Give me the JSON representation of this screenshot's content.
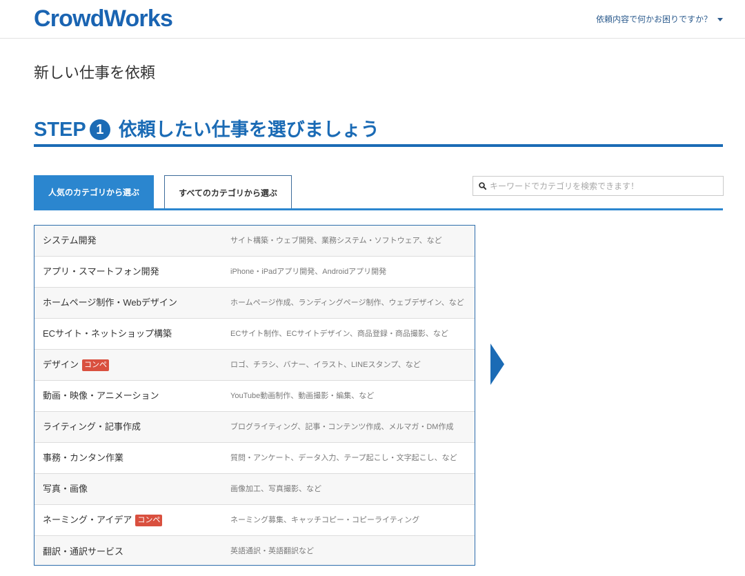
{
  "colors": {
    "brand": "#1a64b2",
    "heading": "#1b6bb5",
    "tab": "#2b86cf",
    "tab-border": "#3b6a9a",
    "list-border": "#2c6cab",
    "badge": "#d9503f",
    "help": "#2d5c8e"
  },
  "header": {
    "logo_text": "CrowdWorks",
    "help_label": "依頼内容で何かお困りですか？",
    "help_icon": "caret-down-icon"
  },
  "page": {
    "title": "新しい仕事を依頼"
  },
  "step": {
    "label": "STEP",
    "number": "1",
    "title": "依頼したい仕事を選びましょう"
  },
  "tabs": [
    {
      "label": "人気のカテゴリから選ぶ",
      "active": true
    },
    {
      "label": "すべてのカテゴリから選ぶ",
      "active": false
    }
  ],
  "search": {
    "icon": "search-icon",
    "placeholder": "キーワードでカテゴリを検索できます！",
    "value": ""
  },
  "categories": [
    {
      "name": "システム開発",
      "description": "サイト構築・ウェブ開発、業務システム・ソフトウェア、など"
    },
    {
      "name": "アプリ・スマートフォン開発",
      "description": "iPhone・iPadアプリ開発、Androidアプリ開発"
    },
    {
      "name": "ホームページ制作・Webデザイン",
      "description": "ホームページ作成、ランディングページ制作、ウェブデザイン、など"
    },
    {
      "name": "ECサイト・ネットショップ構築",
      "description": "ECサイト制作、ECサイトデザイン、商品登録・商品撮影、など"
    },
    {
      "name": "デザイン",
      "badge": "コンペ",
      "description": "ロゴ、チラシ、バナー、イラスト、LINEスタンプ、など"
    },
    {
      "name": "動画・映像・アニメーション",
      "description": "YouTube動画制作、動画撮影・編集、など"
    },
    {
      "name": "ライティング・記事作成",
      "description": "ブログライティング、記事・コンテンツ作成、メルマガ・DM作成"
    },
    {
      "name": "事務・カンタン作業",
      "description": "質問・アンケート、データ入力、テープ起こし・文字起こし、など"
    },
    {
      "name": "写真・画像",
      "description": "画像加工、写真撮影、など"
    },
    {
      "name": "ネーミング・アイデア",
      "badge": "コンペ",
      "description": "ネーミング募集、キャッチコピー・コピーライティング"
    },
    {
      "name": "翻訳・通訳サービス",
      "description": "英語通訳・英語翻訳など"
    }
  ],
  "next_icon": "arrow-right-icon"
}
